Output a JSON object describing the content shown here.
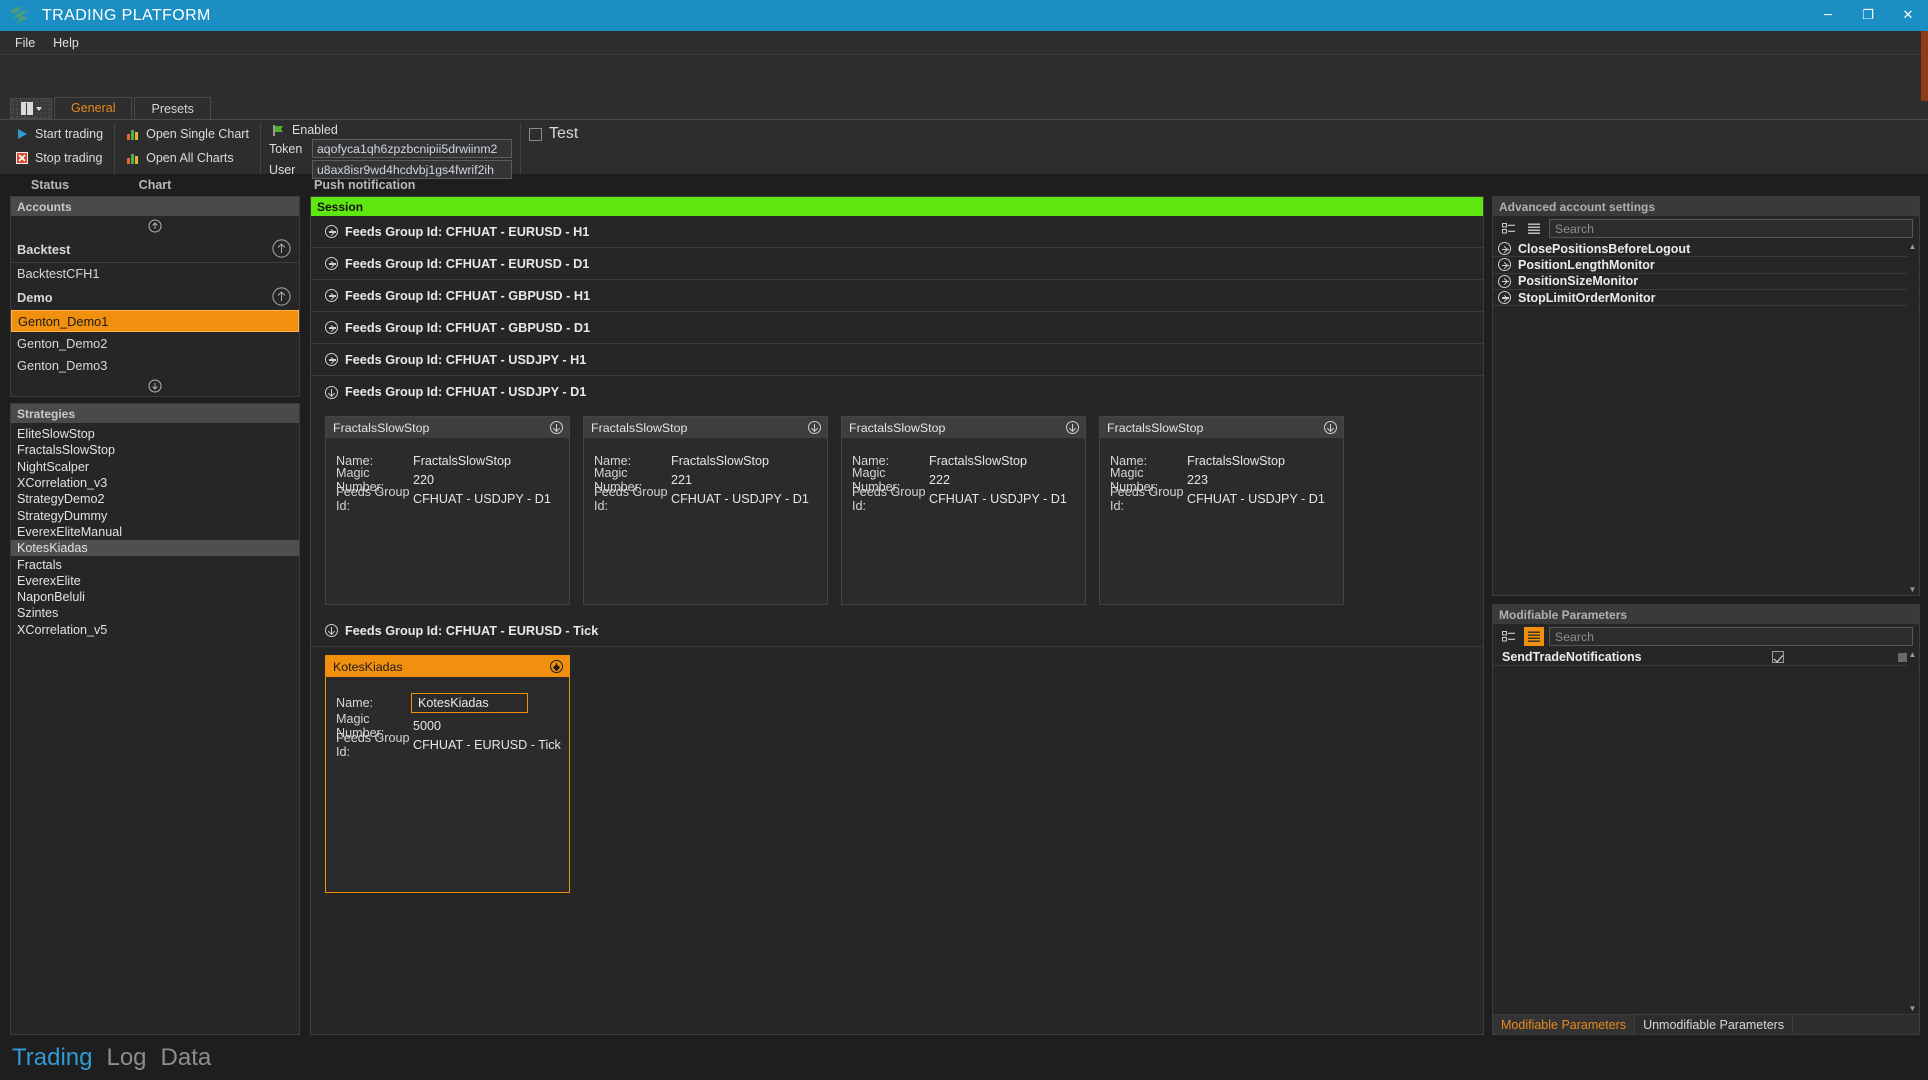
{
  "window": {
    "title": "TRADING PLATFORM",
    "minimize": "─",
    "maximize": "❐",
    "close": "✕"
  },
  "menubar": {
    "items": [
      "File",
      "Help"
    ]
  },
  "ribbon": {
    "tabs": [
      {
        "label": "General",
        "selected": true
      },
      {
        "label": "Presets",
        "selected": false
      }
    ],
    "trading_group": [
      {
        "label": "Start trading",
        "icon": "play-icon"
      },
      {
        "label": "Stop trading",
        "icon": "stop-icon"
      }
    ],
    "chart_group": [
      {
        "label": "Open Single Chart",
        "icon": "bar-chart-icon"
      },
      {
        "label": "Open All Charts",
        "icon": "bar-chart-icon"
      }
    ],
    "push_group": {
      "enabled_label": "Enabled",
      "enabled_icon": "flag-icon",
      "token_label": "Token",
      "token_value": "aqofyca1qh6zpzbcnipii5drwiinm2",
      "user_label": "User",
      "user_value": "u8ax8isr9wd4hcdvbj1gs4fwrif2ih"
    },
    "test_group": {
      "label": "Test",
      "checked": false
    }
  },
  "left": {
    "columns": {
      "status": "Status",
      "chart": "Chart"
    },
    "accounts": {
      "title": "Accounts",
      "items": [
        {
          "label": "Backtest",
          "group": true,
          "has_chart_arrow": true
        },
        {
          "label": "BacktestCFH1",
          "group": false,
          "has_chart_arrow": false
        },
        {
          "label": "Demo",
          "group": true,
          "has_chart_arrow": true
        },
        {
          "label": "Genton_Demo1",
          "group": false,
          "selected": true
        },
        {
          "label": "Genton_Demo2",
          "group": false
        },
        {
          "label": "Genton_Demo3",
          "group": false
        }
      ]
    },
    "strategies": {
      "title": "Strategies",
      "items": [
        {
          "label": "EliteSlowStop"
        },
        {
          "label": "FractalsSlowStop"
        },
        {
          "label": "NightScalper"
        },
        {
          "label": "XCorrelation_v3"
        },
        {
          "label": "StrategyDemo2"
        },
        {
          "label": "StrategyDummy"
        },
        {
          "label": "EverexEliteManual"
        },
        {
          "label": "KotesKiadas",
          "selected": true
        },
        {
          "label": "Fractals"
        },
        {
          "label": "EverexElite"
        },
        {
          "label": "NaponBeluli"
        },
        {
          "label": "Szintes"
        },
        {
          "label": "XCorrelation_v5"
        }
      ]
    }
  },
  "center": {
    "header": "Push notification",
    "session_label": "Session",
    "feed_groups": [
      {
        "label": "Feeds Group Id: CFHUAT - EURUSD - H1",
        "expanded": false
      },
      {
        "label": "Feeds Group Id: CFHUAT - EURUSD - D1",
        "expanded": false
      },
      {
        "label": "Feeds Group Id: CFHUAT - GBPUSD - H1",
        "expanded": false
      },
      {
        "label": "Feeds Group Id: CFHUAT - GBPUSD - D1",
        "expanded": false
      },
      {
        "label": "Feeds Group Id: CFHUAT - USDJPY - H1",
        "expanded": false
      },
      {
        "label": "Feeds Group Id: CFHUAT - USDJPY - D1",
        "expanded": true
      }
    ],
    "usdjpy_cards": [
      {
        "title": "FractalsSlowStop",
        "name_label": "Name:",
        "name": "FractalsSlowStop",
        "magic_label": "Magic Number:",
        "magic": "220",
        "feeds_label": "Feeds Group Id:",
        "feeds": "CFHUAT - USDJPY - D1"
      },
      {
        "title": "FractalsSlowStop",
        "name_label": "Name:",
        "name": "FractalsSlowStop",
        "magic_label": "Magic Number:",
        "magic": "221",
        "feeds_label": "Feeds Group Id:",
        "feeds": "CFHUAT - USDJPY - D1"
      },
      {
        "title": "FractalsSlowStop",
        "name_label": "Name:",
        "name": "FractalsSlowStop",
        "magic_label": "Magic Number:",
        "magic": "222",
        "feeds_label": "Feeds Group Id:",
        "feeds": "CFHUAT - USDJPY - D1"
      },
      {
        "title": "FractalsSlowStop",
        "name_label": "Name:",
        "name": "FractalsSlowStop",
        "magic_label": "Magic Number:",
        "magic": "223",
        "feeds_label": "Feeds Group Id:",
        "feeds": "CFHUAT - USDJPY - D1"
      }
    ],
    "tick_group": {
      "label": "Feeds Group Id: CFHUAT - EURUSD - Tick",
      "expanded": true
    },
    "tick_card": {
      "title": "KotesKiadas",
      "name_label": "Name:",
      "name": "KotesKiadas",
      "magic_label": "Magic Number:",
      "magic": "5000",
      "feeds_label": "Feeds Group Id:",
      "feeds": "CFHUAT - EURUSD - Tick"
    }
  },
  "right": {
    "advanced": {
      "title": "Advanced account settings",
      "search_placeholder": "Search",
      "items": [
        "ClosePositionsBeforeLogout",
        "PositionLengthMonitor",
        "PositionSizeMonitor",
        "StopLimitOrderMonitor"
      ]
    },
    "modifiable": {
      "title": "Modifiable Parameters",
      "search_placeholder": "Search",
      "rows": [
        {
          "name": "SendTradeNotifications",
          "checked": true
        }
      ]
    },
    "tabs": [
      {
        "label": "Modifiable Parameters",
        "selected": true
      },
      {
        "label": "Unmodifiable Parameters",
        "selected": false
      }
    ]
  },
  "bottom": {
    "tabs": [
      {
        "label": "Trading",
        "selected": true
      },
      {
        "label": "Log",
        "selected": false
      },
      {
        "label": "Data",
        "selected": false
      }
    ]
  },
  "colors": {
    "title_blue": "#1b8fc4",
    "accent_orange": "#f0900e",
    "session_green": "#5ee610",
    "tab_orange": "#e8891c",
    "bottom_blue": "#2f9bd4"
  }
}
